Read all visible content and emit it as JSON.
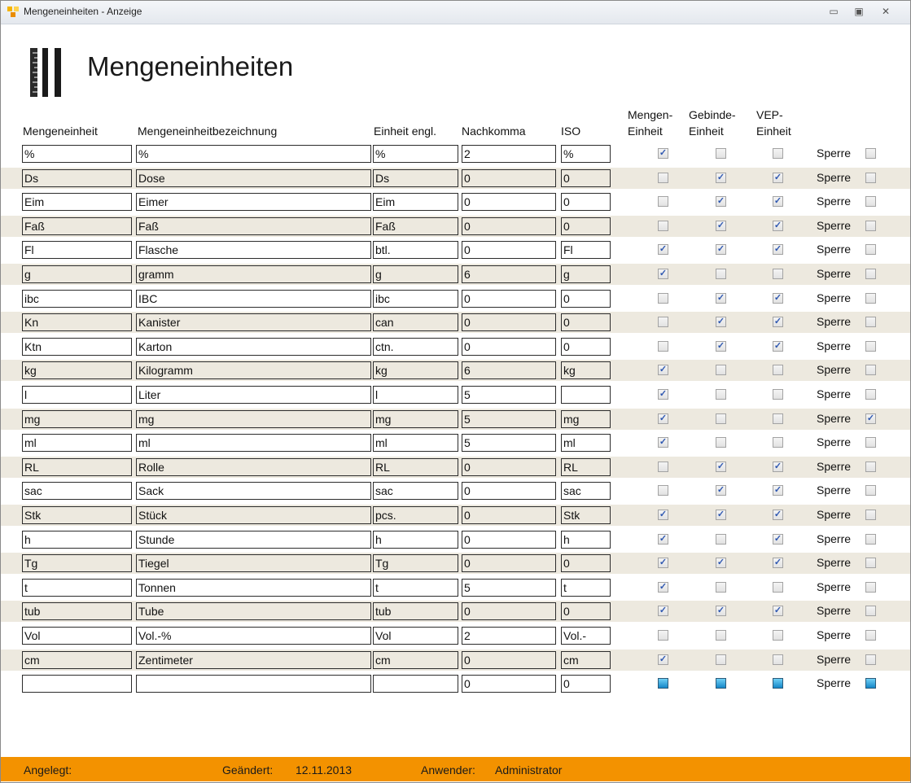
{
  "window": {
    "title": "Mengeneinheiten - Anzeige",
    "min_icon": "minimize-icon",
    "max_icon": "maximize-icon",
    "close_icon": "close-icon"
  },
  "heading": "Mengeneinheiten",
  "columns": {
    "unit": "Mengeneinheit",
    "name": "Mengeneinheitbezeichnung",
    "english": "Einheit engl.",
    "decimals": "Nachkomma",
    "iso": "ISO",
    "mengen": "Mengen-",
    "mengen2": "Einheit",
    "gebinde": "Gebinde-",
    "gebinde2": "Einheit",
    "vep": "VEP-",
    "vep2": "Einheit"
  },
  "sperre_label": "Sperre",
  "rows": [
    {
      "unit": "%",
      "name": "%",
      "english": "%",
      "decimals": "2",
      "iso": "%",
      "mengen": true,
      "gebinde": false,
      "vep": false,
      "sperre": false
    },
    {
      "unit": "Ds",
      "name": "Dose",
      "english": "Ds",
      "decimals": "0",
      "iso": "0",
      "mengen": false,
      "gebinde": true,
      "vep": true,
      "sperre": false
    },
    {
      "unit": "Eim",
      "name": "Eimer",
      "english": "Eim",
      "decimals": "0",
      "iso": "0",
      "mengen": false,
      "gebinde": true,
      "vep": true,
      "sperre": false
    },
    {
      "unit": "Faß",
      "name": "Faß",
      "english": "Faß",
      "decimals": "0",
      "iso": "0",
      "mengen": false,
      "gebinde": true,
      "vep": true,
      "sperre": false
    },
    {
      "unit": "Fl",
      "name": "Flasche",
      "english": "btl.",
      "decimals": "0",
      "iso": "Fl",
      "mengen": true,
      "gebinde": true,
      "vep": true,
      "sperre": false
    },
    {
      "unit": "g",
      "name": "gramm",
      "english": "g",
      "decimals": "6",
      "iso": "g",
      "mengen": true,
      "gebinde": false,
      "vep": false,
      "sperre": false
    },
    {
      "unit": "ibc",
      "name": "IBC",
      "english": "ibc",
      "decimals": "0",
      "iso": "0",
      "mengen": false,
      "gebinde": true,
      "vep": true,
      "sperre": false
    },
    {
      "unit": "Kn",
      "name": "Kanister",
      "english": "can",
      "decimals": "0",
      "iso": "0",
      "mengen": false,
      "gebinde": true,
      "vep": true,
      "sperre": false
    },
    {
      "unit": "Ktn",
      "name": "Karton",
      "english": "ctn.",
      "decimals": "0",
      "iso": "0",
      "mengen": false,
      "gebinde": true,
      "vep": true,
      "sperre": false
    },
    {
      "unit": "kg",
      "name": "Kilogramm",
      "english": "kg",
      "decimals": "6",
      "iso": "kg",
      "mengen": true,
      "gebinde": false,
      "vep": false,
      "sperre": false
    },
    {
      "unit": "l",
      "name": "Liter",
      "english": "l",
      "decimals": "5",
      "iso": "",
      "mengen": true,
      "gebinde": false,
      "vep": false,
      "sperre": false
    },
    {
      "unit": "mg",
      "name": "mg",
      "english": "mg",
      "decimals": "5",
      "iso": "mg",
      "mengen": true,
      "gebinde": false,
      "vep": false,
      "sperre": true
    },
    {
      "unit": "ml",
      "name": "ml",
      "english": "ml",
      "decimals": "5",
      "iso": "ml",
      "mengen": true,
      "gebinde": false,
      "vep": false,
      "sperre": false
    },
    {
      "unit": "RL",
      "name": "Rolle",
      "english": "RL",
      "decimals": "0",
      "iso": "RL",
      "mengen": false,
      "gebinde": true,
      "vep": true,
      "sperre": false
    },
    {
      "unit": "sac",
      "name": "Sack",
      "english": "sac",
      "decimals": "0",
      "iso": "sac",
      "mengen": false,
      "gebinde": true,
      "vep": true,
      "sperre": false
    },
    {
      "unit": "Stk",
      "name": "Stück",
      "english": "pcs.",
      "decimals": "0",
      "iso": "Stk",
      "mengen": true,
      "gebinde": true,
      "vep": true,
      "sperre": false
    },
    {
      "unit": "h",
      "name": "Stunde",
      "english": "h",
      "decimals": "0",
      "iso": "h",
      "mengen": true,
      "gebinde": false,
      "vep": true,
      "sperre": false
    },
    {
      "unit": "Tg",
      "name": "Tiegel",
      "english": "Tg",
      "decimals": "0",
      "iso": "0",
      "mengen": true,
      "gebinde": true,
      "vep": true,
      "sperre": false
    },
    {
      "unit": "t",
      "name": "Tonnen",
      "english": "t",
      "decimals": "5",
      "iso": "t",
      "mengen": true,
      "gebinde": false,
      "vep": false,
      "sperre": false
    },
    {
      "unit": "tub",
      "name": "Tube",
      "english": "tub",
      "decimals": "0",
      "iso": "0",
      "mengen": true,
      "gebinde": true,
      "vep": true,
      "sperre": false
    },
    {
      "unit": "Vol",
      "name": "Vol.-%",
      "english": "Vol",
      "decimals": "2",
      "iso": "Vol.-",
      "mengen": false,
      "gebinde": false,
      "vep": false,
      "sperre": false
    },
    {
      "unit": "cm",
      "name": "Zentimeter",
      "english": "cm",
      "decimals": "0",
      "iso": "cm",
      "mengen": true,
      "gebinde": false,
      "vep": false,
      "sperre": false
    },
    {
      "unit": "",
      "name": "",
      "english": "",
      "decimals": "0",
      "iso": "0",
      "mengen": "new",
      "gebinde": "new",
      "vep": "new",
      "sperre": "new"
    }
  ],
  "footer": {
    "created_label": "Angelegt:",
    "changed_label": "Geändert:",
    "changed_value": "12.11.2013",
    "user_label": "Anwender:",
    "user_value": "Administrator"
  }
}
